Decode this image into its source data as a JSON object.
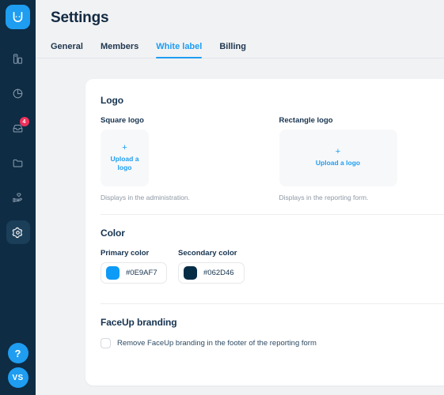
{
  "sidebar": {
    "brand": {
      "name": "faceup-logo",
      "alt": "FaceUp"
    },
    "items": [
      {
        "icon": "bar-chart-icon",
        "name": "sidebar-item-dashboard",
        "active": false,
        "badge": ""
      },
      {
        "icon": "pie-chart-icon",
        "name": "sidebar-item-statistics",
        "active": false,
        "badge": ""
      },
      {
        "icon": "inbox-icon",
        "name": "sidebar-item-inbox",
        "active": false,
        "badge": "4"
      },
      {
        "icon": "folder-icon",
        "name": "sidebar-item-files",
        "active": false,
        "badge": ""
      },
      {
        "icon": "hand-heart-icon",
        "name": "sidebar-item-support",
        "active": false,
        "badge": ""
      },
      {
        "icon": "gear-icon",
        "name": "sidebar-item-settings",
        "active": true,
        "badge": ""
      }
    ],
    "help_label": "?",
    "avatar_initials": "VS"
  },
  "header": {
    "title": "Settings"
  },
  "tabs": [
    {
      "label": "General",
      "active": false
    },
    {
      "label": "Members",
      "active": false
    },
    {
      "label": "White label",
      "active": true
    },
    {
      "label": "Billing",
      "active": false
    }
  ],
  "logo_section": {
    "title": "Logo",
    "square": {
      "label": "Square logo",
      "upload_plus": "+",
      "upload_text": "Upload a logo",
      "caption": "Displays in the administration."
    },
    "rectangle": {
      "label": "Rectangle logo",
      "upload_plus": "+",
      "upload_text": "Upload a logo",
      "caption": "Displays in the reporting form."
    }
  },
  "color_section": {
    "title": "Color",
    "primary": {
      "label": "Primary color",
      "value": "#0E9AF7",
      "swatch": "#0E9AF7"
    },
    "secondary": {
      "label": "Secondary color",
      "value": "#062D46",
      "swatch": "#062D46"
    }
  },
  "branding_section": {
    "title": "FaceUp branding",
    "checkbox_label": "Remove FaceUp branding in the footer of the reporting form",
    "checked": false
  }
}
